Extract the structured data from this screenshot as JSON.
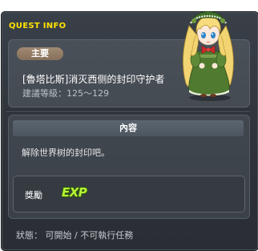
{
  "header": {
    "quest_id": "30010-0",
    "window_title": "QUEST INFO"
  },
  "quest": {
    "category_badge": "主要",
    "title": "[魯塔比斯]消灭西侧的封印守护者",
    "recommended_level": "建議等級：125～129"
  },
  "details": {
    "section_title": "內容",
    "description": "解除世界树的封印吧。",
    "reward_label": "獎勵",
    "reward_icon": "exp-icon",
    "reward_icon_text": "EXP"
  },
  "footer": {
    "status": "狀態： 可開始 / 不可執行任務"
  },
  "npc": {
    "icon": "npc-portrait"
  },
  "colors": {
    "title_yellow": "#ffe400",
    "badge_brown": "#95806a",
    "exp_green": "#b7f23b",
    "panel_dark": "#2e3339"
  }
}
